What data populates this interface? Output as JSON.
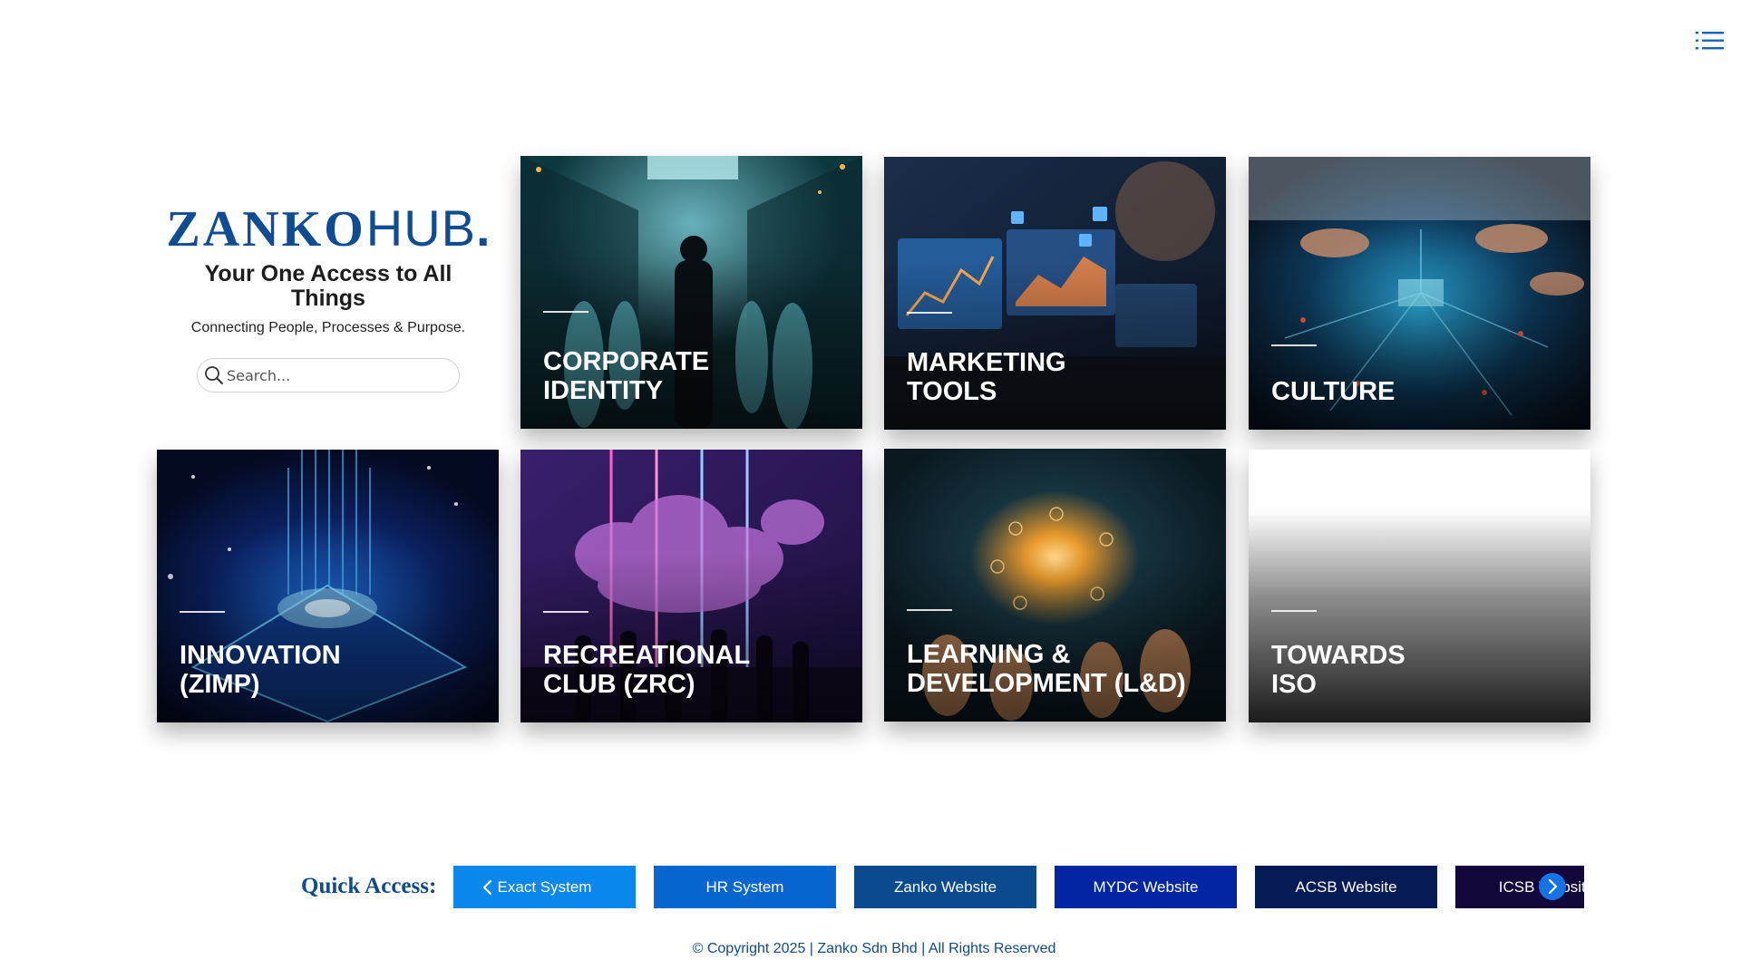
{
  "brand": {
    "logo_bold": "ZANKO",
    "logo_light": "HUB",
    "logo_dot": ".",
    "tagline": "Your One Access to All Things",
    "subtagline": "Connecting People, Processes & Purpose."
  },
  "search": {
    "placeholder": "Search..."
  },
  "cards": [
    {
      "title": "CORPORATE\nIDENTITY"
    },
    {
      "title": "MARKETING\nTOOLS"
    },
    {
      "title": "CULTURE"
    },
    {
      "title": "INNOVATION\n(ZIMP)"
    },
    {
      "title": "RECREATIONAL\nCLUB (ZRC)"
    },
    {
      "title": "LEARNING &\nDEVELOPMENT (L&D)"
    },
    {
      "title": "TOWARDS\nISO"
    }
  ],
  "quick_access": {
    "label": "Quick Access:",
    "items": [
      {
        "label": "Exact System",
        "color": "#0a87ea"
      },
      {
        "label": "HR System",
        "color": "#0866d0"
      },
      {
        "label": "Zanko Website",
        "color": "#0c4a90"
      },
      {
        "label": "MYDC Website",
        "color": "#0324a3"
      },
      {
        "label": "ACSB Website",
        "color": "#061b55"
      },
      {
        "label": "ICSB Website",
        "color": "#12063a"
      }
    ]
  },
  "footer": {
    "text": "© Copyright 2025 | Zanko Sdn Bhd | All Rights Reserved"
  },
  "colors": {
    "brand_blue": "#0f4c92",
    "nav_arrow": "#1473e6"
  },
  "icons": {
    "menu": "list-menu-icon",
    "search": "search-icon",
    "prev": "chevron-left-icon",
    "next": "chevron-right-icon"
  }
}
